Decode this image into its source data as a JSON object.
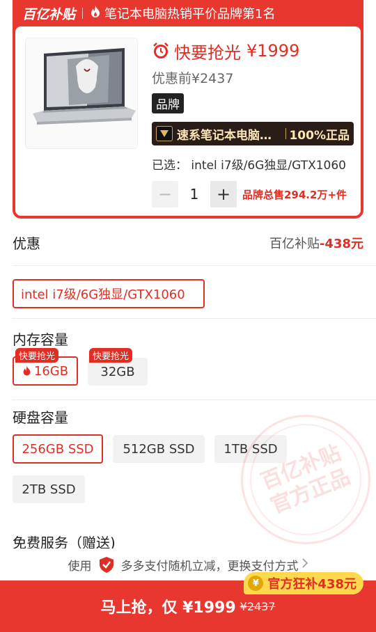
{
  "banner": {
    "logo_text": "百亿补贴",
    "rank_text": "笔记本电脑热销平价品牌第1名"
  },
  "product": {
    "flash_label": "快要抢光",
    "price": "¥1999",
    "price_before": "优惠前¥2437",
    "brand_tag": "品牌",
    "store_name": "速系笔记本电脑官方旗舰店",
    "store_badge": "100%正品",
    "selected_label": "已选：",
    "selected_value": "intel i7级/6G独显/GTX1060",
    "quantity": "1",
    "minus": "−",
    "plus": "+",
    "sales_text": "品牌总售294.2万+件"
  },
  "discount": {
    "label": "优惠",
    "source": "百亿补贴",
    "amount": "-438元"
  },
  "config_option": "intel i7级/6G独显/GTX1060",
  "memory": {
    "title": "内存容量",
    "options": [
      {
        "label": "16GB",
        "tag": "快要抢光",
        "selected": true
      },
      {
        "label": "32GB",
        "tag": "快要抢光",
        "selected": false
      }
    ]
  },
  "storage": {
    "title": "硬盘容量",
    "options": [
      {
        "label": "256GB SSD",
        "selected": true
      },
      {
        "label": "512GB SSD",
        "selected": false
      },
      {
        "label": "1TB SSD",
        "selected": false
      },
      {
        "label": "2TB SSD",
        "selected": false
      }
    ]
  },
  "services": {
    "title": "免费服务（赠送)"
  },
  "stamp": {
    "line1": "百亿补贴",
    "line2": "官方正品"
  },
  "pay": {
    "prefix": "使用",
    "text": "多多支付随机立减，更换支付方式"
  },
  "buy": {
    "main": "马上抢，仅 ¥1999",
    "original": "¥2437",
    "subsidy": "官方狂补438元",
    "coin": "¥"
  },
  "colors": {
    "brand_red": "#e8372f",
    "price_red": "#e02e24",
    "subsidy_yellow": "#ffd84d"
  }
}
